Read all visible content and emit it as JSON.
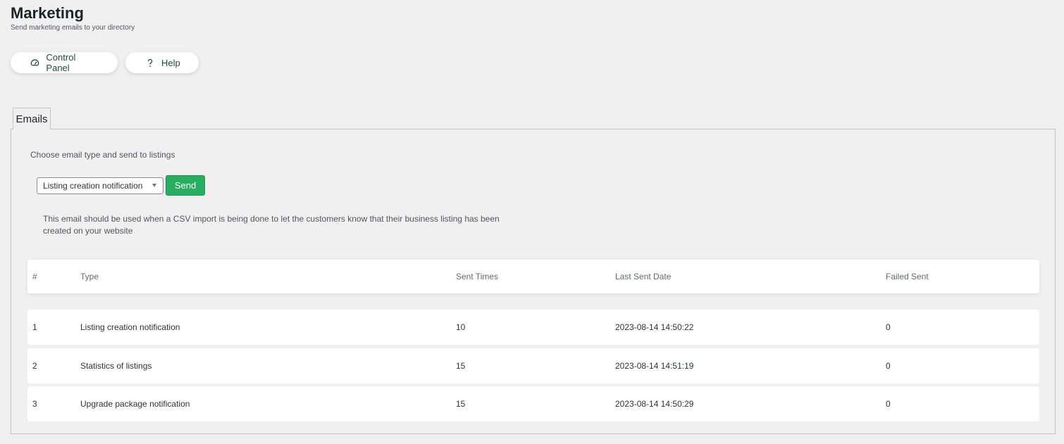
{
  "header": {
    "title": "Marketing",
    "subtitle": "Send marketing emails to your directory"
  },
  "top_buttons": {
    "control_panel": {
      "label": "Control Panel",
      "icon": "dashboard-icon"
    },
    "help": {
      "label": "Help",
      "icon": "question-icon"
    }
  },
  "tabs": [
    {
      "label": "Emails"
    }
  ],
  "panel": {
    "choose_label": "Choose email type and send to listings",
    "select_value": "Listing creation notification",
    "send_label": "Send",
    "description": "This email should be used when a CSV import is being done to let the customers know that their business listing has been created on your website"
  },
  "table": {
    "headers": {
      "num": "#",
      "type": "Type",
      "sent_times": "Sent Times",
      "last_sent_date": "Last Sent Date",
      "failed_sent": "Failed Sent"
    },
    "rows": [
      {
        "num": "1",
        "type": "Listing creation notification",
        "sent_times": "10",
        "last_sent_date": "2023-08-14 14:50:22",
        "failed_sent": "0"
      },
      {
        "num": "2",
        "type": "Statistics of listings",
        "sent_times": "15",
        "last_sent_date": "2023-08-14 14:51:19",
        "failed_sent": "0"
      },
      {
        "num": "3",
        "type": "Upgrade package notification",
        "sent_times": "15",
        "last_sent_date": "2023-08-14 14:50:29",
        "failed_sent": "0"
      }
    ]
  },
  "colors": {
    "background": "#f0f0f1",
    "send_button": "#27ae60",
    "button_text": "#1e4d3a"
  }
}
